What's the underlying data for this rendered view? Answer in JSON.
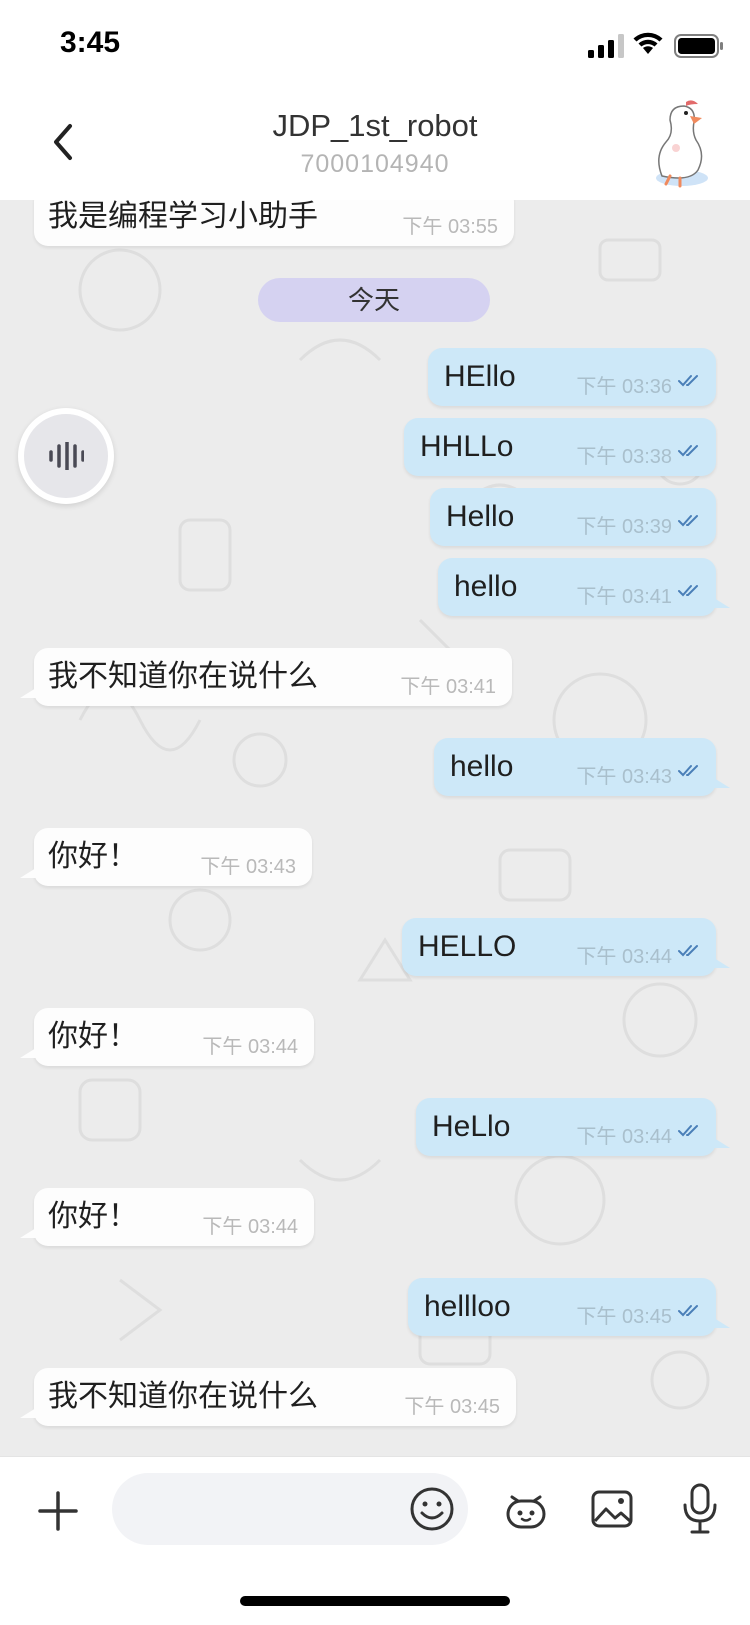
{
  "status_bar": {
    "time": "3:45"
  },
  "header": {
    "title": "JDP_1st_robot",
    "subtitle": "7000104940"
  },
  "date_separator": "今天",
  "messages": [
    {
      "dir": "in",
      "text": "我是编程学习小助手",
      "time": "下午 03:55"
    },
    {
      "dir": "out",
      "text": "HEllo",
      "time": "下午 03:36"
    },
    {
      "dir": "out",
      "text": "HHLLo",
      "time": "下午 03:38"
    },
    {
      "dir": "out",
      "text": "Hello",
      "time": "下午 03:39"
    },
    {
      "dir": "out",
      "text": "hello",
      "time": "下午 03:41"
    },
    {
      "dir": "in",
      "text": "我不知道你在说什么",
      "time": "下午 03:41"
    },
    {
      "dir": "out",
      "text": "hello",
      "time": "下午 03:43"
    },
    {
      "dir": "in",
      "text": "你好！",
      "time": "下午 03:43"
    },
    {
      "dir": "out",
      "text": "HELLO",
      "time": "下午 03:44"
    },
    {
      "dir": "in",
      "text": "你好！",
      "time": "下午 03:44"
    },
    {
      "dir": "out",
      "text": "HeLlo",
      "time": "下午 03:44"
    },
    {
      "dir": "in",
      "text": "你好！",
      "time": "下午 03:44"
    },
    {
      "dir": "out",
      "text": "hellloo",
      "time": "下午 03:45"
    },
    {
      "dir": "in",
      "text": "我不知道你在说什么",
      "time": "下午 03:45"
    }
  ],
  "input": {
    "value": "",
    "placeholder": ""
  },
  "icons": {
    "back": "chevron-left-icon",
    "avatar": "goose-avatar",
    "voice": "voice-waveform-icon",
    "plus": "plus-icon",
    "emoji": "smiley-icon",
    "robot": "robot-icon",
    "image": "image-icon",
    "mic": "microphone-icon",
    "read": "double-check-icon"
  },
  "colors": {
    "outgoing_bubble": "#cde8f8",
    "incoming_bubble": "#fdfdfd",
    "date_pill": "#d5d2f1",
    "chat_background": "#ececec",
    "read_check": "#4a7fb8"
  }
}
